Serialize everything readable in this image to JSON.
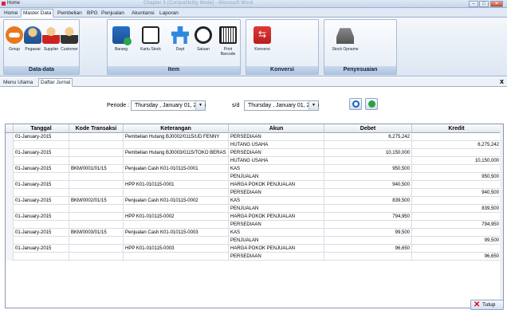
{
  "window": {
    "title": "Home",
    "blurred_title": "Chapter 5 [Compatibility Mode] - Microsoft Word",
    "minimize": "–",
    "maximize": "□",
    "close": "✕"
  },
  "menu_tabs": [
    "Home",
    "Master Data",
    "Pembelian",
    "BPG",
    "Penjualan",
    "Akuntansi",
    "Laporan"
  ],
  "active_menu_tab": "Master Data",
  "ribbon": {
    "groups": [
      {
        "label": "Data-data",
        "buttons": [
          {
            "label": "Group",
            "icon": "group-icon"
          },
          {
            "label": "Pegawai",
            "icon": "employee-icon"
          },
          {
            "label": "Supplier",
            "icon": "supplier-icon"
          },
          {
            "label": "Customer",
            "icon": "customer-icon"
          }
        ]
      },
      {
        "label": "Item",
        "buttons": [
          {
            "label": "Barang",
            "icon": "goods-icon"
          },
          {
            "label": "Kartu Stock",
            "icon": "stock-card-icon"
          },
          {
            "label": "Dept",
            "icon": "department-icon"
          },
          {
            "label": "Satuan",
            "icon": "scale-icon"
          },
          {
            "label": "Print Barcode",
            "icon": "barcode-printer-icon"
          }
        ]
      },
      {
        "label": "Konversi",
        "buttons": [
          {
            "label": "Konversi",
            "icon": "conversion-icon"
          }
        ]
      },
      {
        "label": "Penyesuaian",
        "buttons": [
          {
            "label": "Stock Opname",
            "icon": "stock-opname-icon"
          }
        ]
      }
    ]
  },
  "doc_tabs": [
    "Menu Utama",
    "Daftar Jurnal"
  ],
  "active_doc_tab": "Daftar Jurnal",
  "filter": {
    "period_label": "Periode :",
    "start_date": "Thursday  ,  January  01, 2015",
    "sd_label": "s/d",
    "end_date": "Thursday  ,  January  01, 2015",
    "search_icon": "magnifier-icon",
    "refresh_icon": "refresh-icon"
  },
  "table": {
    "columns": [
      "Tanggal",
      "Kode Transaksi",
      "Keterangan",
      "Akun",
      "Debet",
      "Kredit"
    ],
    "rows": [
      [
        "01-January-2015",
        "",
        "Pembelian Hutang BJ0002/0115/UD FENNY",
        "PERSEDIAAN",
        "6,275,242",
        ""
      ],
      [
        "",
        "",
        "",
        "HUTANG USAHA",
        "",
        "6,275,242"
      ],
      [
        "01-January-2015",
        "",
        "Pembelian Hutang BJ0003/0115/TOKO BERAS",
        "PERSEDIAAN",
        "10,150,000",
        ""
      ],
      [
        "",
        "",
        "",
        "HUTANG USAHA",
        "",
        "10,150,000"
      ],
      [
        "01-January-2015",
        "BKM/0001/01/15",
        "Penjualan Cash K01-010115-0001",
        "KAS",
        "950,500",
        ""
      ],
      [
        "",
        "",
        "",
        "PENJUALAN",
        "",
        "950,500"
      ],
      [
        "01-January-2015",
        "",
        "HPP K01-010115-0001",
        "HARGA POKOK PENJUALAN",
        "940,500",
        ""
      ],
      [
        "",
        "",
        "",
        "PERSEDIAAN",
        "",
        "940,500"
      ],
      [
        "01-January-2015",
        "BKM/0002/01/15",
        "Penjualan Cash K01-010115-0002",
        "KAS",
        "839,500",
        ""
      ],
      [
        "",
        "",
        "",
        "PENJUALAN",
        "",
        "839,500"
      ],
      [
        "01-January-2015",
        "",
        "HPP K01-010115-0002",
        "HARGA POKOK PENJUALAN",
        "794,950",
        ""
      ],
      [
        "",
        "",
        "",
        "PERSEDIAAN",
        "",
        "794,950"
      ],
      [
        "01-January-2015",
        "BKM/0003/01/15",
        "Penjualan Cash K01-010115-0003",
        "KAS",
        "99,500",
        ""
      ],
      [
        "",
        "",
        "",
        "PENJUALAN",
        "",
        "99,500"
      ],
      [
        "01-January-2015",
        "",
        "HPP K01-010115-0003",
        "HARGA POKOK PENJUALAN",
        "96,650",
        ""
      ],
      [
        "",
        "",
        "",
        "PERSEDIAAN",
        "",
        "96,650"
      ]
    ]
  },
  "close_button": "Tutup",
  "close_button_icon": "x-icon",
  "close_doc_icon": "x"
}
